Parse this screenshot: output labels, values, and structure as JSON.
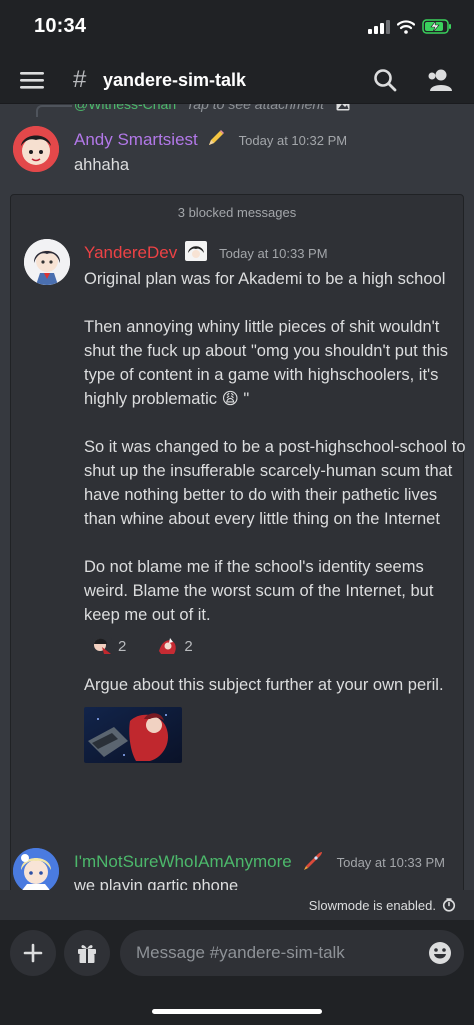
{
  "status_bar": {
    "time": "10:34"
  },
  "header": {
    "channel_prefix": "#",
    "channel_name": "yandere-sim-talk"
  },
  "colors": {
    "accent_red": "#ed4245",
    "author_purple": "#b278e8",
    "author_green": "#4cb86b",
    "background": "#36393f",
    "panel": "#2f3136",
    "topbar": "#202225"
  },
  "reply_preview": {
    "name": "@Witness-Chan",
    "text": "Tap to see attachment"
  },
  "messages": [
    {
      "author": "Andy Smartsiest",
      "badge_icon": "pencil-emoji",
      "timestamp": "Today at 10:32 PM",
      "text": "ahhaha"
    },
    {
      "author": "YandereDev",
      "timestamp": "Today at 10:33 PM",
      "paragraphs": [
        "Original plan was for Akademi to be a high school",
        "Then annoying whiny little pieces of shit wouldn't shut the fuck up about \"omg you shouldn't put this type of content in a game with highschoolers, it's highly problematic 😩 \"",
        "So it was changed to be a post-highschool-school to shut up the insufferable scarcely-human scum that have nothing better to do with their pathetic lives than whine about every little thing on the Internet",
        "Do not blame me if the school's identity seems weird. Blame the worst scum of the Internet, but keep me out of it."
      ],
      "reactions": [
        {
          "count": "2"
        },
        {
          "count": "2"
        }
      ],
      "followup": "Argue about this subject further at your own peril."
    },
    {
      "author": "I'mNotSureWhoIAmAnymore",
      "badge_icon": "rocket-emoji",
      "timestamp": "Today at 10:33 PM",
      "text": "we playin gartic phone"
    }
  ],
  "blocked": {
    "label": "3 blocked messages"
  },
  "slowmode": {
    "text": "Slowmode is enabled."
  },
  "composer": {
    "placeholder": "Message #yandere-sim-talk"
  }
}
